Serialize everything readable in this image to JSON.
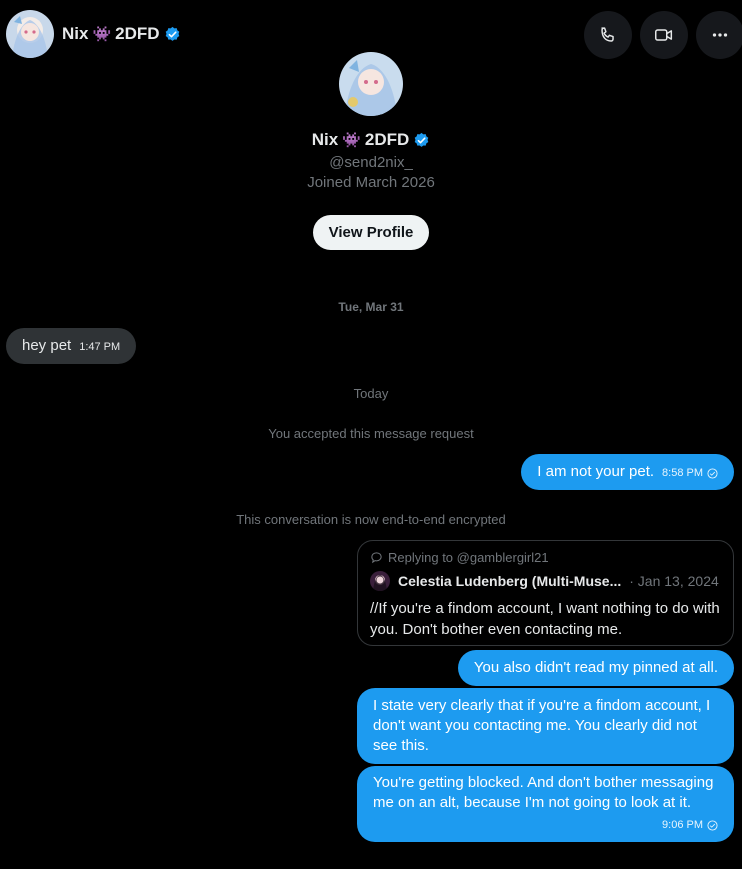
{
  "header": {
    "display_name": "Nix",
    "name_suffix": "2DFD",
    "emoji": "👾",
    "buttons": [
      "phone-icon",
      "video-icon",
      "more-icon"
    ]
  },
  "profile": {
    "display_name": "Nix",
    "name_suffix": "2DFD",
    "emoji": "👾",
    "handle": "@send2nix_",
    "joined": "Joined March 2026",
    "view_profile_label": "View Profile"
  },
  "conversation": {
    "date_1": "Tue, Mar 31",
    "msg_1": {
      "text": "hey pet",
      "time": "1:47 PM"
    },
    "date_2": "Today",
    "accepted_notice": "You accepted this message request",
    "msg_2": {
      "text": "I am not your pet.",
      "time": "8:58 PM"
    },
    "encrypted_notice": "This conversation is now end-to-end encrypted",
    "quote": {
      "replying_to": "Replying to @gamblergirl21",
      "author": "Celestia Ludenberg (Multi-Muse...",
      "date": "· Jan 13, 2024",
      "text": "//If you're a findom account, I want nothing to do with you. Don't bother even contacting me."
    },
    "msg_3": {
      "text": "You also didn't read my pinned at all."
    },
    "msg_4": {
      "text": "I state very clearly that if you're a findom account, I don't want you contacting me. You clearly did not see this."
    },
    "msg_5": {
      "text": "You're getting blocked. And don't bother messaging me on an alt, because I'm not going to look at it.",
      "time": "9:06 PM"
    }
  },
  "colors": {
    "background": "#000000",
    "outgoing_bubble": "#1d9bf0",
    "incoming_bubble": "#2f3336",
    "muted_text": "#71767b",
    "verified": "#1d9bf0"
  }
}
